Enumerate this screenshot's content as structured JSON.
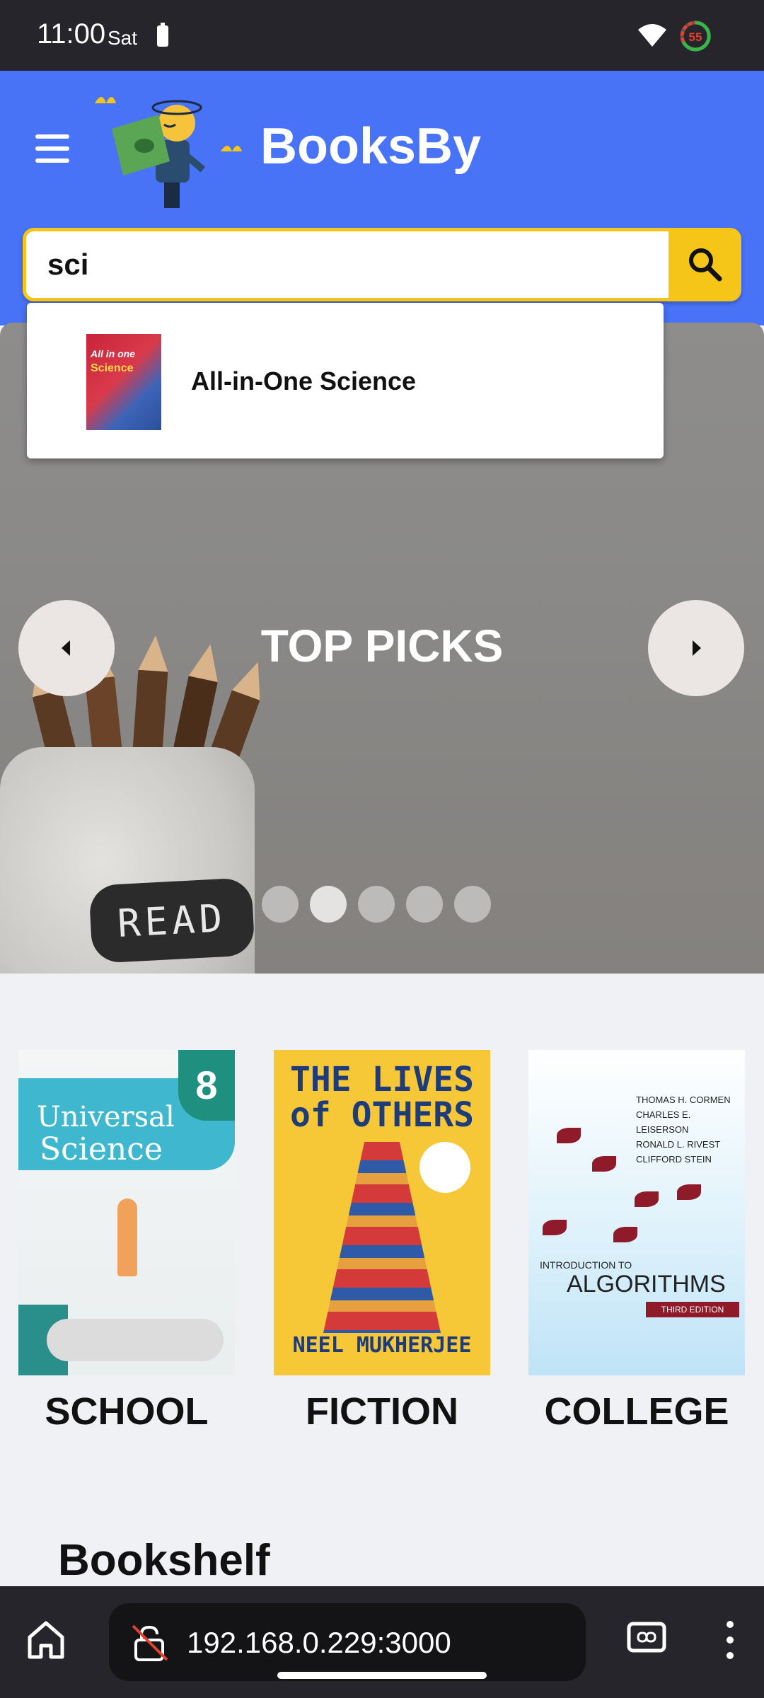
{
  "status_bar": {
    "time": "11:00",
    "day": "Sat",
    "battery_percent": "55"
  },
  "header": {
    "brand": "BooksBy",
    "menu_icon": "hamburger-menu-icon",
    "colors": {
      "header_bg": "#4873f7",
      "accent": "#f5c518"
    }
  },
  "search": {
    "value": "sci",
    "placeholder": ""
  },
  "suggestions": [
    {
      "title": "All-in-One Science",
      "cover_line1": "All in one",
      "cover_line2": "Science"
    }
  ],
  "hero": {
    "title": "TOP PICKS",
    "jar_label": "READ",
    "slide_count": 5,
    "active_slide": 2
  },
  "categories": [
    {
      "label": "SCHOOL",
      "cover": {
        "grade": "8",
        "title_line1": "Universal",
        "title_line2": "Science"
      }
    },
    {
      "label": "FICTION",
      "cover": {
        "title_line1": "THE LIVES",
        "title_line2": "of OTHERS",
        "author": "NEEL MUKHERJEE"
      }
    },
    {
      "label": "COLLEGE",
      "cover": {
        "authors": [
          "THOMAS H. CORMEN",
          "CHARLES E. LEISERSON",
          "RONALD L. RIVEST",
          "CLIFFORD STEIN"
        ],
        "intro": "INTRODUCTION TO",
        "title": "ALGORITHMS",
        "edition": "THIRD EDITION"
      }
    }
  ],
  "bookshelf": {
    "heading": "Bookshelf"
  },
  "browser": {
    "url": "192.168.0.229:3000"
  }
}
